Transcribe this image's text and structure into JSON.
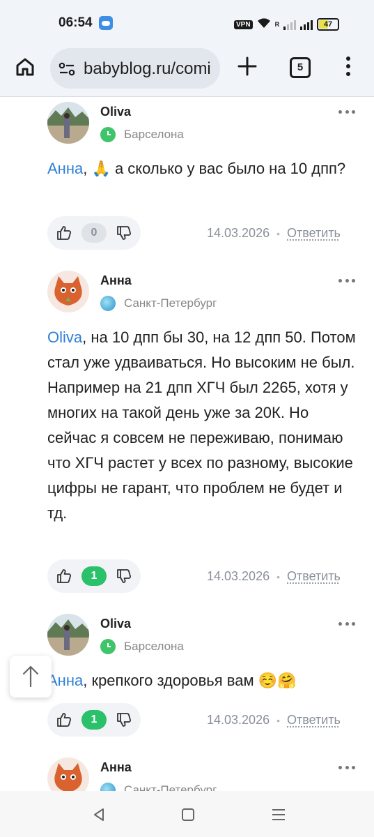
{
  "status": {
    "time": "06:54",
    "vpn": "VPN",
    "roaming": "R",
    "battery": "47"
  },
  "browser": {
    "url": "babyblog.ru/comi",
    "tab_count": "5"
  },
  "comments": [
    {
      "author": "Oliva",
      "location": "Барселона",
      "location_icon": "clock-green-icon",
      "mention": "Анна",
      "text_after": ", 🙏 а сколько у вас было на 10 дпп?",
      "votes": "0",
      "date": "14.03.2026",
      "reply": "Ответить"
    },
    {
      "author": "Анна",
      "location": "Санкт-Петербург",
      "location_icon": "globe-icon",
      "mention": "Oliva",
      "text_after": ", на 10 дпп бы 30, на 12 дпп 50. Потом стал уже удваиваться. Но высоким не был. Например на 21 дпп ХГЧ был 2265, хотя у многих на такой день уже за 20К. Но сейчас я совсем не переживаю, понимаю что ХГЧ растет у всех по разному, высокие цифры не гарант, что проблем не будет и тд.",
      "votes": "1",
      "date": "14.03.2026",
      "reply": "Ответить"
    },
    {
      "author": "Oliva",
      "location": "Барселона",
      "location_icon": "clock-green-icon",
      "mention": "Анна",
      "text_after": ", крепкого здоровья вам ☺️🤗",
      "votes": "1",
      "date": "14.03.2026",
      "reply": "Ответить"
    },
    {
      "author": "Анна",
      "location": "Санкт-Петербург",
      "location_icon": "globe-icon"
    }
  ],
  "colors": {
    "accent": "#2d7fd6",
    "vote_positive": "#2bc06a",
    "meta_gray": "#8a9099"
  }
}
